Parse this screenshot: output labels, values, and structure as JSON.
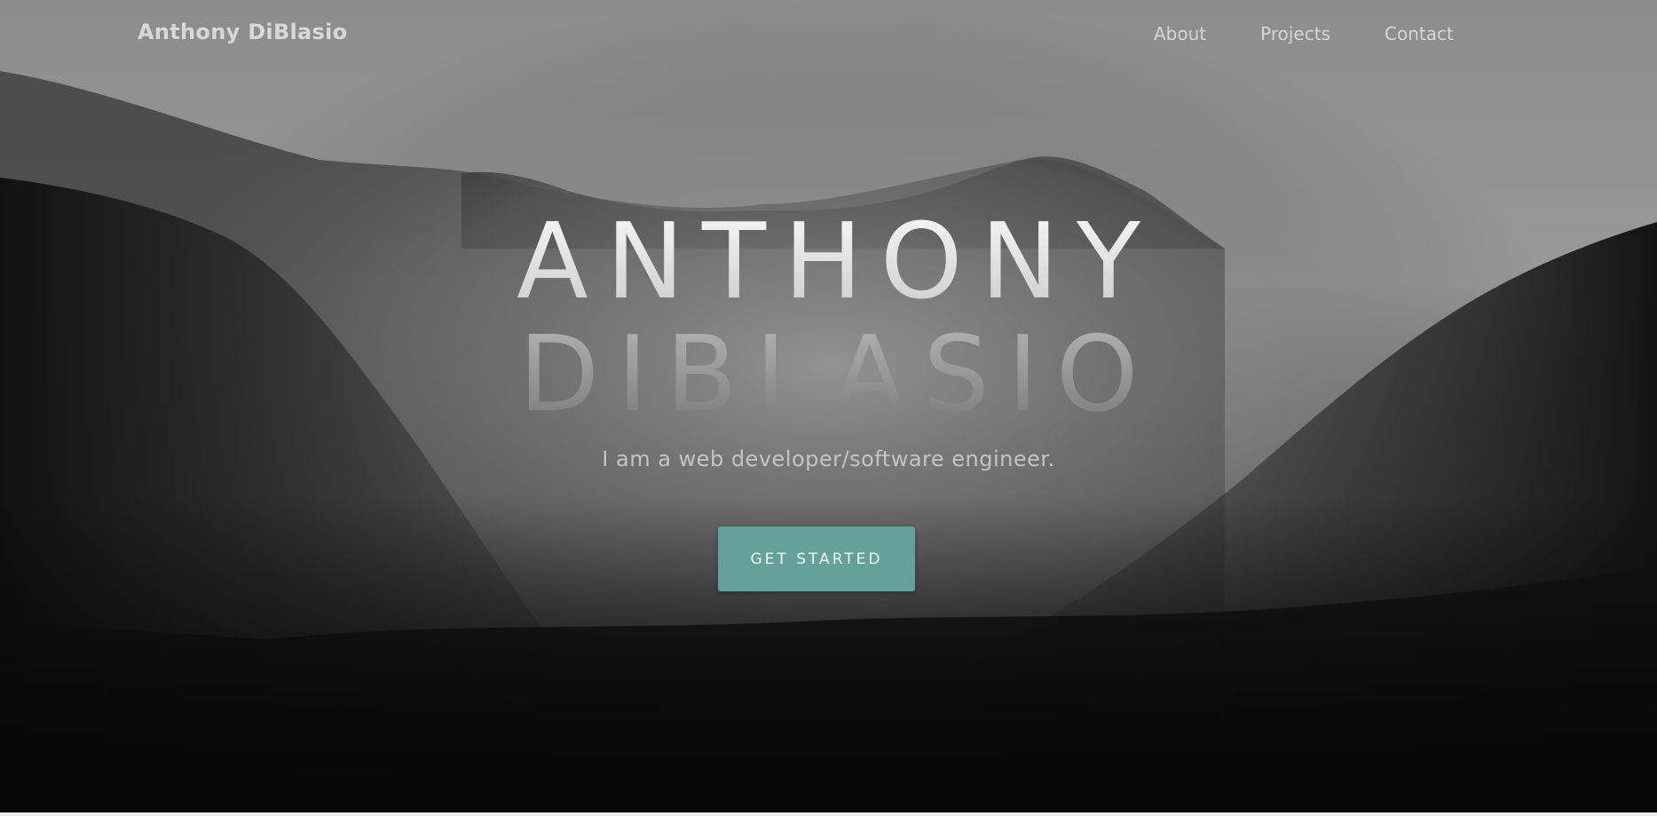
{
  "navbar": {
    "brand": "Anthony DiBlasio",
    "links": [
      "About",
      "Projects",
      "Contact"
    ]
  },
  "hero": {
    "title_first": "ANTHONY",
    "title_last": "DIBLASIO",
    "tagline": "I am a web developer/software engineer.",
    "cta_label": "GET STARTED",
    "background_image": "misty-mountain-forest-image"
  },
  "colors": {
    "accent": "#64a19b",
    "nav_text": "#d6d6d6"
  }
}
